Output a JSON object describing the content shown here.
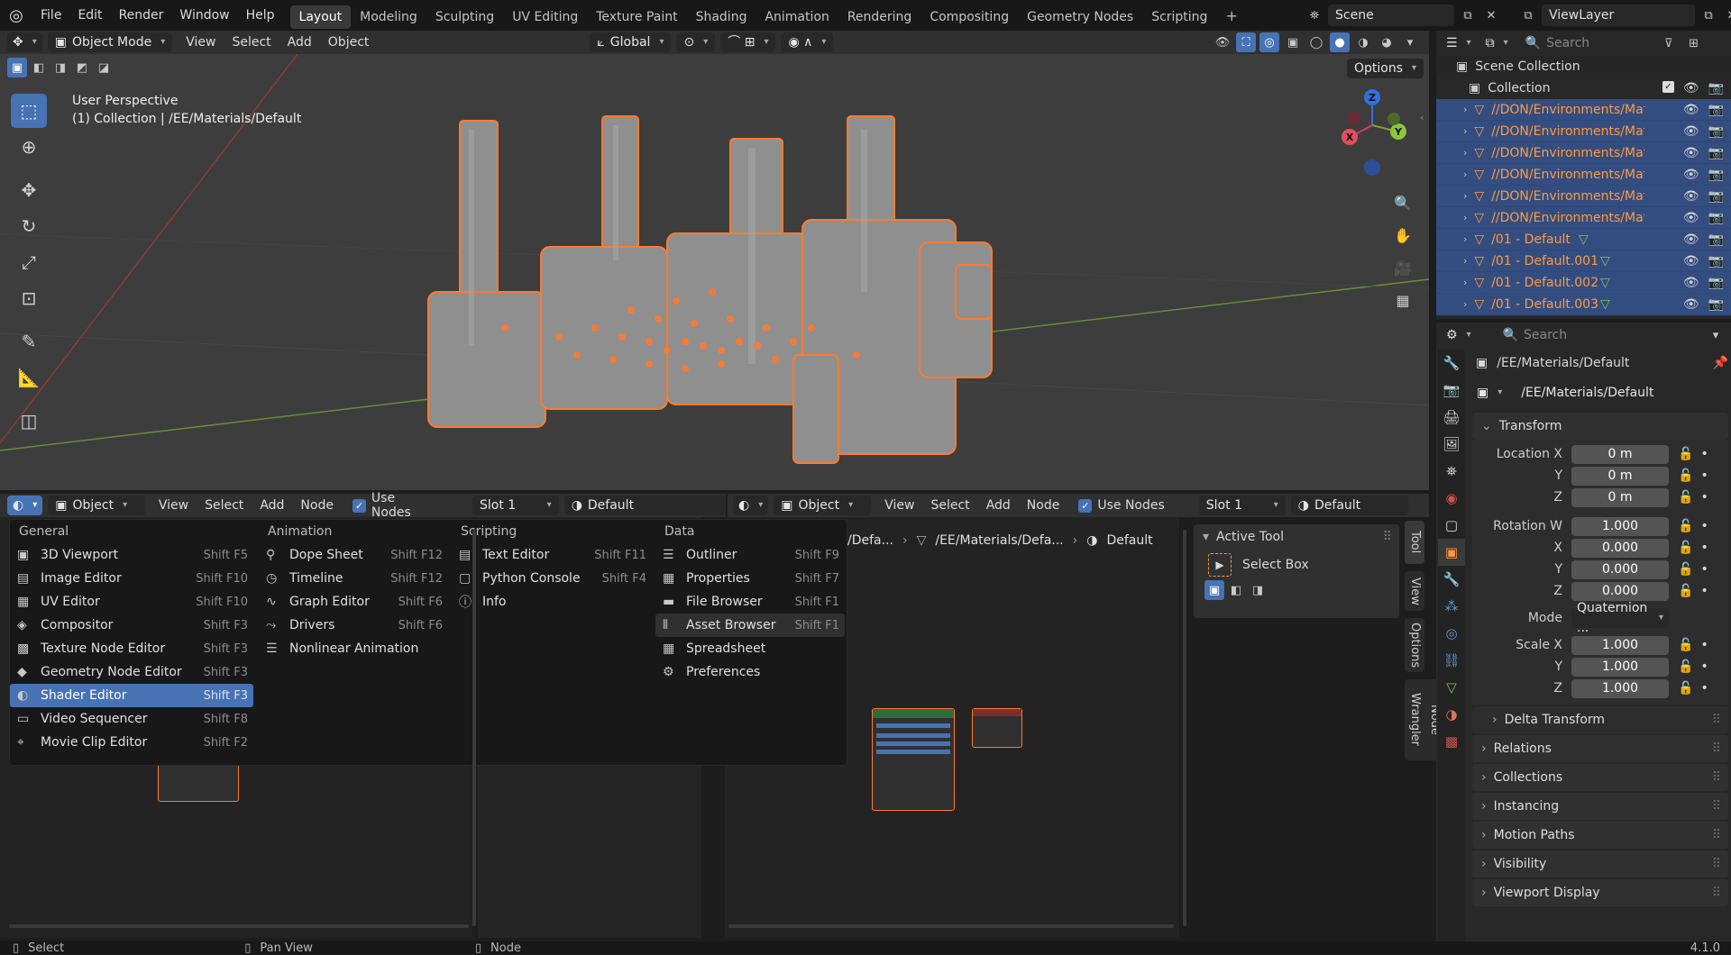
{
  "topbar": {
    "menus": [
      "File",
      "Edit",
      "Render",
      "Window",
      "Help"
    ],
    "workspaces": [
      "Layout",
      "Modeling",
      "Sculpting",
      "UV Editing",
      "Texture Paint",
      "Shading",
      "Animation",
      "Rendering",
      "Compositing",
      "Geometry Nodes",
      "Scripting"
    ],
    "active_workspace": "Layout",
    "add_tab": "+",
    "scene": "Scene",
    "view_layer": "ViewLayer"
  },
  "viewport": {
    "mode": "Object Mode",
    "menus": [
      "View",
      "Select",
      "Add",
      "Object"
    ],
    "transform_orientation": "Global",
    "options": "Options",
    "overlay_title": "User Perspective",
    "overlay_subtitle": "(1) Collection | /EE/Materials/Default",
    "gizmo": {
      "x": "X",
      "y": "Y",
      "z": "Z"
    }
  },
  "shader_header": {
    "object_type": "Object",
    "menus": [
      "View",
      "Select",
      "Add",
      "Node"
    ],
    "use_nodes": "Use Nodes",
    "slot": "Slot 1",
    "material": "Default"
  },
  "breadcrumb": [
    "/Defa...",
    "/EE/Materials/Defa...",
    "Default"
  ],
  "sidebar_npanel": {
    "panel_title": "Active Tool",
    "tool_name": "Select Box",
    "tabs": [
      "Tool",
      "View",
      "Options",
      "Node Wrangler"
    ]
  },
  "editor_menu": {
    "columns": [
      {
        "title": "General",
        "items": [
          {
            "label": "3D Viewport",
            "shortcut": "Shift F5",
            "icon": "3d-viewport-icon",
            "glyph": "▣"
          },
          {
            "label": "Image Editor",
            "shortcut": "Shift F10",
            "icon": "image-editor-icon",
            "glyph": "▤"
          },
          {
            "label": "UV Editor",
            "shortcut": "Shift F10",
            "icon": "uv-editor-icon",
            "glyph": "▦"
          },
          {
            "label": "Compositor",
            "shortcut": "Shift F3",
            "icon": "compositor-icon",
            "glyph": "◈"
          },
          {
            "label": "Texture Node Editor",
            "shortcut": "Shift F3",
            "icon": "texture-node-icon",
            "glyph": "▩"
          },
          {
            "label": "Geometry Node Editor",
            "shortcut": "Shift F3",
            "icon": "geometry-node-icon",
            "glyph": "◆"
          },
          {
            "label": "Shader Editor",
            "shortcut": "Shift F3",
            "icon": "shader-editor-icon",
            "glyph": "◐"
          },
          {
            "label": "Video Sequencer",
            "shortcut": "Shift F8",
            "icon": "video-sequencer-icon",
            "glyph": "▭"
          },
          {
            "label": "Movie Clip Editor",
            "shortcut": "Shift F2",
            "icon": "movie-clip-icon",
            "glyph": "⌖"
          }
        ]
      },
      {
        "title": "Animation",
        "items": [
          {
            "label": "Dope Sheet",
            "shortcut": "Shift F12",
            "icon": "dope-sheet-icon",
            "glyph": "⚲"
          },
          {
            "label": "Timeline",
            "shortcut": "Shift F12",
            "icon": "timeline-icon",
            "glyph": "◷"
          },
          {
            "label": "Graph Editor",
            "shortcut": "Shift F6",
            "icon": "graph-editor-icon",
            "glyph": "∿"
          },
          {
            "label": "Drivers",
            "shortcut": "Shift F6",
            "icon": "drivers-icon",
            "glyph": "⤳"
          },
          {
            "label": "Nonlinear Animation",
            "shortcut": "",
            "icon": "nla-icon",
            "glyph": "☰"
          }
        ]
      },
      {
        "title": "Scripting",
        "items": [
          {
            "label": "Text Editor",
            "shortcut": "Shift F11",
            "icon": "text-editor-icon",
            "glyph": "▤"
          },
          {
            "label": "Python Console",
            "shortcut": "Shift F4",
            "icon": "python-console-icon",
            "glyph": "▢"
          },
          {
            "label": "Info",
            "shortcut": "",
            "icon": "info-icon",
            "glyph": "ⓘ"
          }
        ]
      },
      {
        "title": "Data",
        "items": [
          {
            "label": "Outliner",
            "shortcut": "Shift F9",
            "icon": "outliner-icon",
            "glyph": "☰"
          },
          {
            "label": "Properties",
            "shortcut": "Shift F7",
            "icon": "properties-icon",
            "glyph": "▦"
          },
          {
            "label": "File Browser",
            "shortcut": "Shift F1",
            "icon": "file-browser-icon",
            "glyph": "▬"
          },
          {
            "label": "Asset Browser",
            "shortcut": "Shift F1",
            "icon": "asset-browser-icon",
            "glyph": "⫴"
          },
          {
            "label": "Spreadsheet",
            "shortcut": "",
            "icon": "spreadsheet-icon",
            "glyph": "▦"
          },
          {
            "label": "Preferences",
            "shortcut": "",
            "icon": "preferences-icon",
            "glyph": "⚙"
          }
        ]
      }
    ],
    "selected": "Shader Editor",
    "hovered": "Asset Browser"
  },
  "outliner": {
    "search_placeholder": "Search",
    "root": "Scene Collection",
    "collection": "Collection",
    "items": [
      {
        "name": "//DON/Environments/Mate",
        "mesh": false
      },
      {
        "name": "//DON/Environments/Mate",
        "mesh": false
      },
      {
        "name": "//DON/Environments/Mate",
        "mesh": false
      },
      {
        "name": "//DON/Environments/Mate",
        "mesh": false
      },
      {
        "name": "//DON/Environments/Mate",
        "mesh": false
      },
      {
        "name": "//DON/Environments/Mate",
        "mesh": false
      },
      {
        "name": "/01 - Default",
        "mesh": true
      },
      {
        "name": "/01 - Default.001",
        "mesh": true
      },
      {
        "name": "/01 - Default.002",
        "mesh": true
      },
      {
        "name": "/01 - Default.003",
        "mesh": true
      }
    ]
  },
  "properties": {
    "search_placeholder": "Search",
    "object_path": "/EE/Materials/Default",
    "object_name": "/EE/Materials/Default",
    "transform_title": "Transform",
    "location": {
      "x_label": "Location X",
      "y_label": "Y",
      "z_label": "Z",
      "x": "0 m",
      "y": "0 m",
      "z": "0 m"
    },
    "rotation": {
      "w_label": "Rotation W",
      "x_label": "X",
      "y_label": "Y",
      "z_label": "Z",
      "w": "1.000",
      "x": "0.000",
      "y": "0.000",
      "z": "0.000"
    },
    "mode_label": "Mode",
    "mode_value": "Quaternion ...",
    "scale": {
      "x_label": "Scale X",
      "y_label": "Y",
      "z_label": "Z",
      "x": "1.000",
      "y": "1.000",
      "z": "1.000"
    },
    "sections": [
      "Delta Transform",
      "Relations",
      "Collections",
      "Instancing",
      "Motion Paths",
      "Visibility",
      "Viewport Display"
    ]
  },
  "status": {
    "select": "Select",
    "pan": "Pan View",
    "node": "Node",
    "version": "4.1.0"
  },
  "colors": {
    "accent": "#4772b3",
    "orange": "#ff7a2e",
    "outline_sel": "#334d80"
  }
}
